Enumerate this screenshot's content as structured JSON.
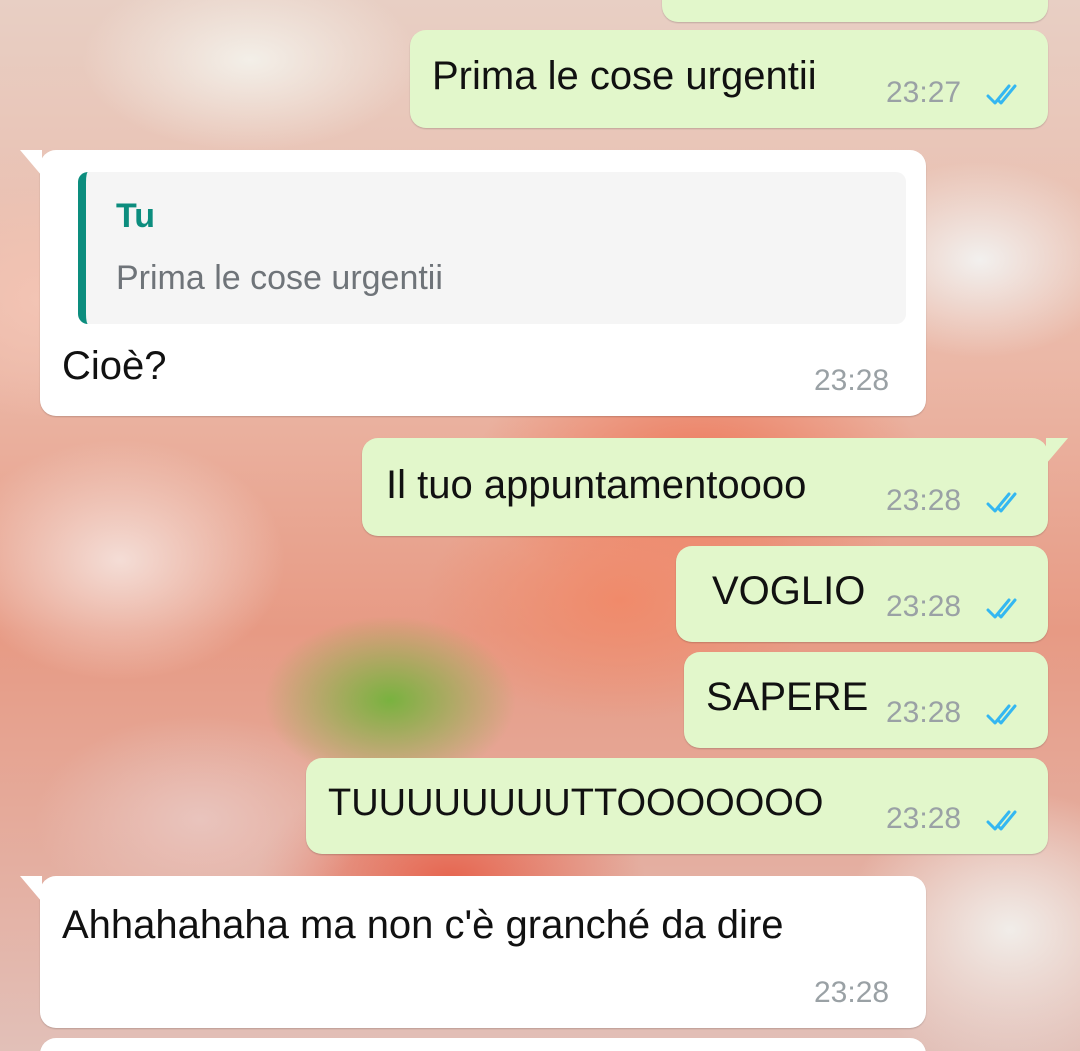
{
  "accent_color": "#0c8d7e",
  "tick_color": "#34b7f1",
  "messages": [
    {
      "text": "",
      "direction": "outgoing",
      "partially_visible": true
    },
    {
      "text": "Prima le cose urgentii",
      "time": "23:27",
      "direction": "outgoing",
      "status_icon": "double-check-read-icon"
    },
    {
      "text": "Cioè?",
      "time": "23:28",
      "direction": "incoming",
      "reply_to": {
        "author": "Tu",
        "text": "Prima le cose urgentii"
      }
    },
    {
      "text": "Il tuo appuntamentoooo",
      "time": "23:28",
      "direction": "outgoing",
      "status_icon": "double-check-read-icon"
    },
    {
      "text": "VOGLIO",
      "time": "23:28",
      "direction": "outgoing",
      "status_icon": "double-check-read-icon"
    },
    {
      "text": "SAPERE",
      "time": "23:28",
      "direction": "outgoing",
      "status_icon": "double-check-read-icon"
    },
    {
      "text": "TUUUUUUUUTTOOOOOOO",
      "time": "23:28",
      "direction": "outgoing",
      "status_icon": "double-check-read-icon"
    },
    {
      "text": "Ahhahahaha ma non c'è granché da dire",
      "time": "23:28",
      "direction": "incoming"
    },
    {
      "text": "",
      "direction": "incoming",
      "partially_visible": true
    }
  ]
}
